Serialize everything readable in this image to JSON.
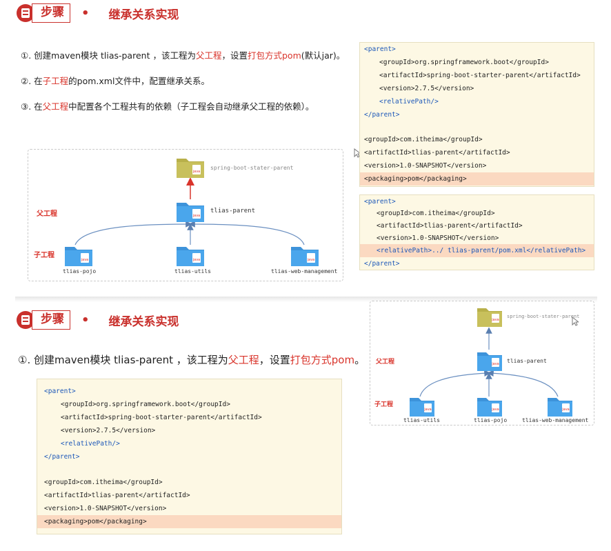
{
  "top": {
    "header": {
      "box": "步骤",
      "dot": "•",
      "title": "继承关系实现"
    },
    "step1": {
      "a": "①. 创建maven模块 tlias-parent ，该工程为",
      "b": "父工程",
      "c": "，设置",
      "d": "打包方式pom",
      "e": "(默认jar)。"
    },
    "step2": {
      "a": "②. 在",
      "b": "子工程",
      "c": "的pom.xml文件中，配置继承关系。"
    },
    "step3": {
      "a": "③. 在",
      "b": "父工程",
      "c": "中配置各个工程共有的依赖（子工程会自动继承父工程的依赖）。"
    },
    "diagram": {
      "top_label": "spring-boot-stater-parent",
      "parent_label": "tlias-parent",
      "parent_role": "父工程",
      "child_role": "子工程",
      "children": [
        "tlias-pojo",
        "tlias-utils",
        "tlias-web-management"
      ]
    },
    "code_parent": [
      "<parent>",
      "<groupId>org.springframework.boot</groupId>",
      "<artifactId>spring-boot-starter-parent</artifactId>",
      "<version>2.7.5</version>",
      "<relativePath/>",
      "</parent>",
      "",
      "<groupId>com.itheima</groupId>",
      "<artifactId>tlias-parent</artifactId>",
      "<version>1.0-SNAPSHOT</version>",
      "<packaging>pom</packaging>"
    ],
    "code_child": [
      "<parent>",
      "<groupId>com.itheima</groupId>",
      "<artifactId>tlias-parent</artifactId>",
      "<version>1.0-SNAPSHOT</version>",
      "<relativePath>../ tlias-parent/pom.xml</relativePath>",
      "</parent>"
    ]
  },
  "bottom": {
    "header": {
      "box": "步骤",
      "dot": "•",
      "title": "继承关系实现"
    },
    "step1": {
      "a": "①. 创建maven模块 tlias-parent ，该工程为",
      "b": "父工程",
      "c": "，设置",
      "d": "打包方式pom",
      "e": "。"
    },
    "diagram": {
      "top_label": "spring-boot-stater-parent",
      "parent_label": "tlias-parent",
      "parent_role": "父工程",
      "child_role": "子工程",
      "children": [
        "tlias-utils",
        "tlias-pojo",
        "tlias-web-management"
      ]
    },
    "code_parent": [
      "<parent>",
      "<groupId>org.springframework.boot</groupId>",
      "<artifactId>spring-boot-starter-parent</artifactId>",
      "<version>2.7.5</version>",
      "<relativePath/>",
      "</parent>",
      "",
      "<groupId>com.itheima</groupId>",
      "<artifactId>tlias-parent</artifactId>",
      "<version>1.0-SNAPSHOT</version>",
      "<packaging>pom</packaging>"
    ]
  },
  "colors": {
    "accent": "#c9302c",
    "tag": "#1a56b8",
    "code_bg": "#fdf8e4",
    "highlight": "#fbd9c1",
    "folder": "#4aa6ec",
    "jar_folder": "#b8b04a",
    "arrow_red": "#d9342b",
    "arrow_blue": "#5a7fb0"
  },
  "icons": {
    "header": "document-icon",
    "folder": "folder-icon",
    "java": "java-file-icon",
    "cursor": "mouse-cursor-icon"
  }
}
